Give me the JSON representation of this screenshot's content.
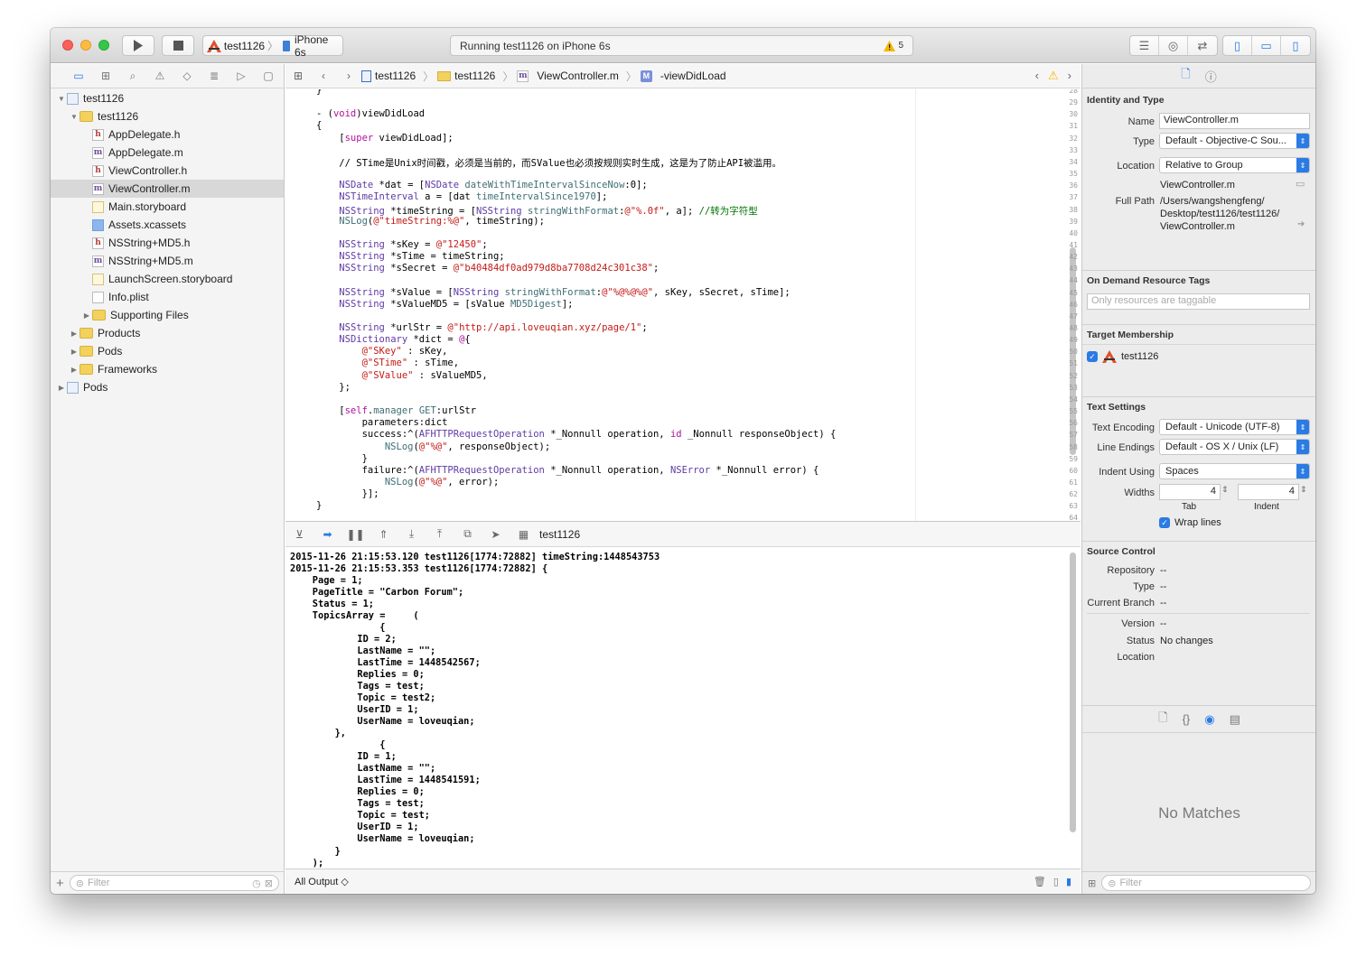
{
  "toolbar": {
    "scheme_target": "test1126",
    "scheme_device": "iPhone 6s",
    "activity_status": "Running test1126 on iPhone 6s",
    "warning_count": "5"
  },
  "navigator": {
    "filter_placeholder": "Filter",
    "tree": [
      {
        "label": "test1126",
        "indent": 0,
        "icon": "project-icon",
        "tri": "▼",
        "selected": false
      },
      {
        "label": "test1126",
        "indent": 1,
        "icon": "folder-icon",
        "tri": "▼",
        "selected": false
      },
      {
        "label": "AppDelegate.h",
        "indent": 2,
        "icon": "h-file-icon",
        "tri": "",
        "selected": false
      },
      {
        "label": "AppDelegate.m",
        "indent": 2,
        "icon": "m-file-icon",
        "tri": "",
        "selected": false
      },
      {
        "label": "ViewController.h",
        "indent": 2,
        "icon": "h-file-icon",
        "tri": "",
        "selected": false
      },
      {
        "label": "ViewController.m",
        "indent": 2,
        "icon": "m-file-icon",
        "tri": "",
        "selected": true
      },
      {
        "label": "Main.storyboard",
        "indent": 2,
        "icon": "storyboard-icon",
        "tri": "",
        "selected": false
      },
      {
        "label": "Assets.xcassets",
        "indent": 2,
        "icon": "assets-icon",
        "tri": "",
        "selected": false
      },
      {
        "label": "NSString+MD5.h",
        "indent": 2,
        "icon": "h-file-icon",
        "tri": "",
        "selected": false
      },
      {
        "label": "NSString+MD5.m",
        "indent": 2,
        "icon": "m-file-icon",
        "tri": "",
        "selected": false
      },
      {
        "label": "LaunchScreen.storyboard",
        "indent": 2,
        "icon": "storyboard-icon",
        "tri": "",
        "selected": false
      },
      {
        "label": "Info.plist",
        "indent": 2,
        "icon": "plist-icon",
        "tri": "",
        "selected": false
      },
      {
        "label": "Supporting Files",
        "indent": 2,
        "icon": "folder-icon",
        "tri": "▶",
        "selected": false
      },
      {
        "label": "Products",
        "indent": 1,
        "icon": "folder-icon",
        "tri": "▶",
        "selected": false
      },
      {
        "label": "Pods",
        "indent": 1,
        "icon": "folder-icon",
        "tri": "▶",
        "selected": false
      },
      {
        "label": "Frameworks",
        "indent": 1,
        "icon": "folder-icon",
        "tri": "▶",
        "selected": false
      },
      {
        "label": "Pods",
        "indent": 0,
        "icon": "project-icon",
        "tri": "▶",
        "selected": false
      }
    ]
  },
  "jumpbar": {
    "crumbs": [
      "test1126",
      "test1126",
      "ViewController.m",
      "-viewDidLoad"
    ]
  },
  "code": {
    "lines": [
      {
        "n": "28",
        "t": "}"
      },
      {
        "n": "29",
        "t": ""
      },
      {
        "n": "30",
        "t": "- (void)viewDidLoad"
      },
      {
        "n": "31",
        "t": "{"
      },
      {
        "n": "32",
        "t": "    [super viewDidLoad];"
      },
      {
        "n": "33",
        "t": ""
      },
      {
        "n": "34",
        "t": "    // STime是Unix时间戳，必须是当前的，而SValue也必须按规则实时生成，这是为了防止API被滥用。"
      },
      {
        "n": "35",
        "t": ""
      },
      {
        "n": "36",
        "t": "    NSDate *dat = [NSDate dateWithTimeIntervalSinceNow:0];"
      },
      {
        "n": "37",
        "t": "    NSTimeInterval a = [dat timeIntervalSince1970];"
      },
      {
        "n": "38",
        "t": "    NSString *timeString = [NSString stringWithFormat:@\"%.0f\", a]; //转为字符型"
      },
      {
        "n": "39",
        "t": "    NSLog(@\"timeString:%@\", timeString);"
      },
      {
        "n": "40",
        "t": ""
      },
      {
        "n": "41",
        "t": "    NSString *sKey = @\"12450\";"
      },
      {
        "n": "42",
        "t": "    NSString *sTime = timeString;"
      },
      {
        "n": "43",
        "t": "    NSString *sSecret = @\"b40484df0ad979d8ba7708d24c301c38\";"
      },
      {
        "n": "44",
        "t": ""
      },
      {
        "n": "45",
        "t": "    NSString *sValue = [NSString stringWithFormat:@\"%@%@%@\", sKey, sSecret, sTime];"
      },
      {
        "n": "46",
        "t": "    NSString *sValueMD5 = [sValue MD5Digest];"
      },
      {
        "n": "47",
        "t": ""
      },
      {
        "n": "48",
        "t": "    NSString *urlStr = @\"http://api.loveuqian.xyz/page/1\";"
      },
      {
        "n": "49",
        "t": "    NSDictionary *dict = @{"
      },
      {
        "n": "50",
        "t": "        @\"SKey\" : sKey,"
      },
      {
        "n": "51",
        "t": "        @\"STime\" : sTime,"
      },
      {
        "n": "52",
        "t": "        @\"SValue\" : sValueMD5,"
      },
      {
        "n": "53",
        "t": "    };"
      },
      {
        "n": "54",
        "t": ""
      },
      {
        "n": "55",
        "t": "    [self.manager GET:urlStr"
      },
      {
        "n": "56",
        "t": "        parameters:dict"
      },
      {
        "n": "57",
        "t": "        success:^(AFHTTPRequestOperation *_Nonnull operation, id _Nonnull responseObject) {"
      },
      {
        "n": "58",
        "t": "            NSLog(@\"%@\", responseObject);"
      },
      {
        "n": "59",
        "t": "        }"
      },
      {
        "n": "60",
        "t": "        failure:^(AFHTTPRequestOperation *_Nonnull operation, NSError *_Nonnull error) {"
      },
      {
        "n": "61",
        "t": "            NSLog(@\"%@\", error);"
      },
      {
        "n": "62",
        "t": "        }];"
      },
      {
        "n": "63",
        "t": "}"
      },
      {
        "n": "64",
        "t": ""
      }
    ]
  },
  "debug": {
    "process": "test1126"
  },
  "console": {
    "lines": [
      "2015-11-26 21:15:53.120 test1126[1774:72882] timeString:1448543753",
      "2015-11-26 21:15:53.353 test1126[1774:72882] {",
      "    Page = 1;",
      "    PageTitle = \"Carbon Forum\";",
      "    Status = 1;",
      "    TopicsArray =     (",
      "                {",
      "            ID = 2;",
      "            LastName = \"\";",
      "            LastTime = 1448542567;",
      "            Replies = 0;",
      "            Tags = test;",
      "            Topic = test2;",
      "            UserID = 1;",
      "            UserName = loveuqian;",
      "        },",
      "                {",
      "            ID = 1;",
      "            LastName = \"\";",
      "            LastTime = 1448541591;",
      "            Replies = 0;",
      "            Tags = test;",
      "            Topic = test;",
      "            UserID = 1;",
      "            UserName = loveuqian;",
      "        }",
      "    );"
    ],
    "output_selector": "All Output ◇"
  },
  "inspector": {
    "identity": {
      "title": "Identity and Type",
      "name_label": "Name",
      "name_value": "ViewController.m",
      "type_label": "Type",
      "type_value": "Default - Objective-C Sou...",
      "location_label": "Location",
      "location_value": "Relative to Group",
      "location_file": "ViewController.m",
      "fullpath_label": "Full Path",
      "fullpath_1": "/Users/wangshengfeng/",
      "fullpath_2": "Desktop/test1126/test1126/",
      "fullpath_3": "ViewController.m"
    },
    "ondemand": {
      "title": "On Demand Resource Tags",
      "placeholder": "Only resources are taggable"
    },
    "target": {
      "title": "Target Membership",
      "item": "test1126"
    },
    "text": {
      "title": "Text Settings",
      "encoding_label": "Text Encoding",
      "encoding_value": "Default - Unicode (UTF-8)",
      "endings_label": "Line Endings",
      "endings_value": "Default - OS X / Unix (LF)",
      "indent_label": "Indent Using",
      "indent_value": "Spaces",
      "widths_label": "Widths",
      "tab_value": "4",
      "indent_width_value": "4",
      "tab_caption": "Tab",
      "indent_caption": "Indent",
      "wrap_label": "Wrap lines"
    },
    "source": {
      "title": "Source Control",
      "repository_label": "Repository",
      "repository_value": "--",
      "type_label": "Type",
      "type_value": "--",
      "branch_label": "Current Branch",
      "branch_value": "--",
      "version_label": "Version",
      "version_value": "--",
      "status_label": "Status",
      "status_value": "No changes",
      "location_label": "Location"
    },
    "library": {
      "no_matches": "No Matches",
      "filter_placeholder": "Filter"
    }
  }
}
